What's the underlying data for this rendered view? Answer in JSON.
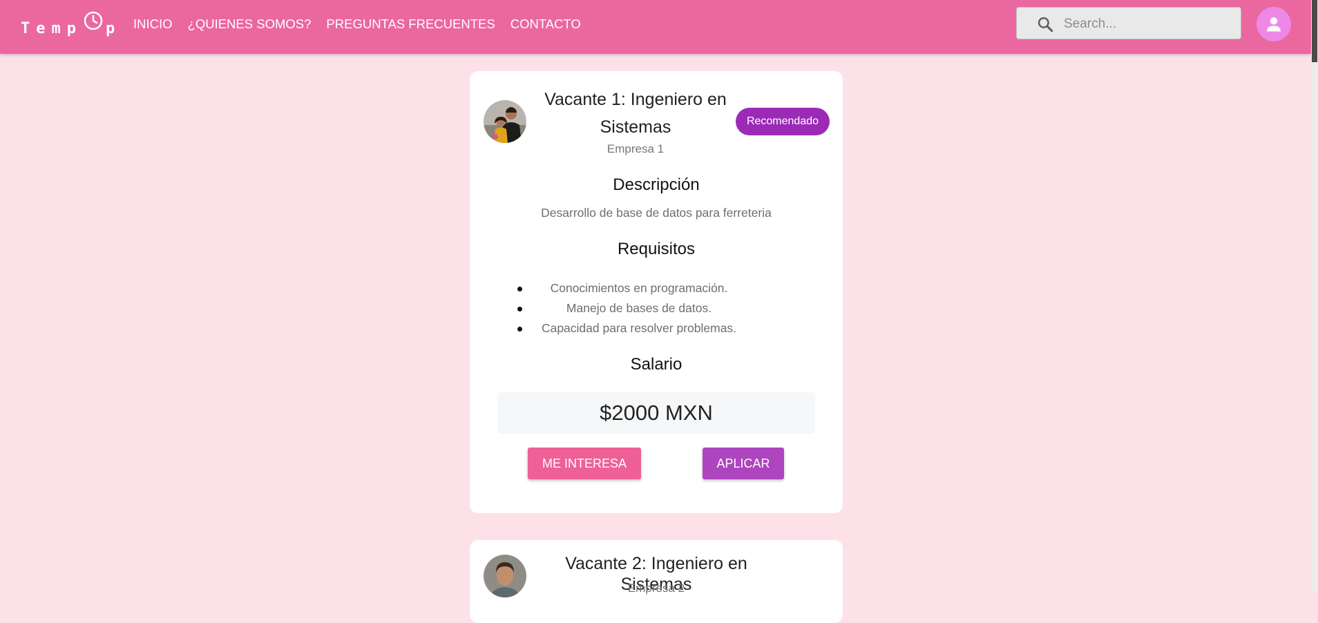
{
  "navbar": {
    "logo_letters": "Temp",
    "logo_tail": "p",
    "links": [
      "INICIO",
      "¿QUIENES SOMOS?",
      "PREGUNTAS FRECUENTES",
      "CONTACTO"
    ],
    "search_placeholder": "Search...",
    "colors": {
      "background": "#ea679f",
      "avatar": "#ee88e6"
    },
    "icons": [
      "clock-icon",
      "search-icon",
      "user-icon"
    ]
  },
  "page": {
    "background": "#fde1e8"
  },
  "vacancies": [
    {
      "title": "Vacante 1: Ingeniero en Sistemas",
      "company": "Empresa 1",
      "badge": "Recomendado",
      "description_heading": "Descripción",
      "description": "Desarrollo de base de datos para ferreteria",
      "requirements_heading": "Requisitos",
      "requirements": [
        "Conocimientos en programación.",
        "Manejo de bases de datos.",
        "Capacidad para resolver problemas."
      ],
      "salary_heading": "Salario",
      "salary": "$2000 MXN",
      "interest_label": "ME INTERESA",
      "apply_label": "APLICAR"
    },
    {
      "title": "Vacante 2: Ingeniero en Sistemas",
      "company": "Empresa 2"
    }
  ],
  "colors": {
    "badge": "#9b2bb6",
    "interest_button": "#ef6196",
    "apply_button": "#ad45bf"
  }
}
